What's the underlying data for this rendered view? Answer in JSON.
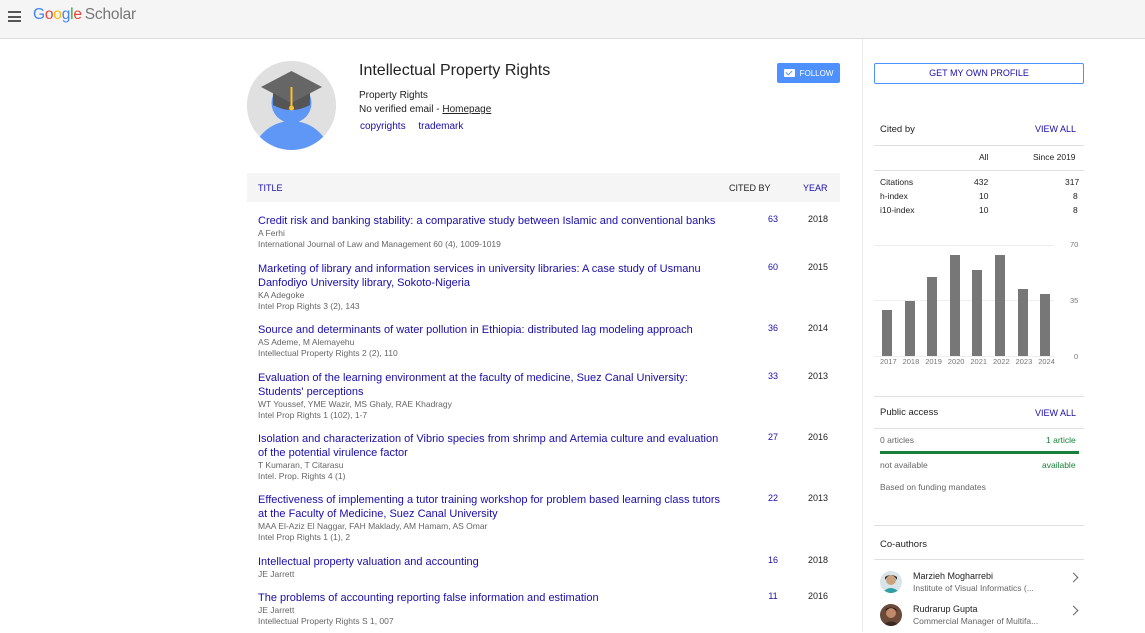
{
  "header": {
    "logo_google": "Google",
    "logo_scholar": "Scholar",
    "logo_colors": [
      "#4285f4",
      "#ea4335",
      "#fbbc05",
      "#4285f4",
      "#34a853",
      "#ea4335"
    ]
  },
  "profile": {
    "name": "Intellectual Property Rights",
    "affiliation": "Property Rights",
    "email_text": "No verified email - ",
    "homepage_label": "Homepage",
    "interests": [
      "copyrights",
      "trademark"
    ],
    "follow_label": "FOLLOW"
  },
  "table": {
    "col_title": "TITLE",
    "col_cited_by": "CITED BY",
    "col_year": "YEAR",
    "rows": [
      {
        "title": "Credit risk and banking stability: a comparative study between Islamic and conventional banks",
        "authors": "A Ferhi",
        "venue": "International Journal of Law and Management 60 (4), 1009-1019",
        "cited": "63",
        "year": "2018"
      },
      {
        "title": "Marketing of library and information services in university libraries: A case study of Usmanu Danfodiyo University library, Sokoto-Nigeria",
        "authors": "KA Adegoke",
        "venue": "Intel Prop Rights 3 (2), 143",
        "cited": "60",
        "year": "2015"
      },
      {
        "title": "Source and determinants of water pollution in Ethiopia: distributed lag modeling approach",
        "authors": "AS Ademe, M Alemayehu",
        "venue": "Intellectual Property Rights 2 (2), 110",
        "cited": "36",
        "year": "2014"
      },
      {
        "title": "Evaluation of the learning environment at the faculty of medicine, Suez Canal University: Students' perceptions",
        "authors": "WT Youssef, YME Wazir, MS Ghaly, RAE Khadragy",
        "venue": "Intel Prop Rights 1 (102), 1-7",
        "cited": "33",
        "year": "2013"
      },
      {
        "title": "Isolation and characterization of Vibrio species from shrimp and Artemia culture and evaluation of the potential virulence factor",
        "authors": "T Kumaran, T Citarasu",
        "venue": "Intel. Prop. Rights 4 (1)",
        "cited": "27",
        "year": "2016"
      },
      {
        "title": "Effectiveness of implementing a tutor training workshop for problem based learning class tutors at the Faculty of Medicine, Suez Canal University",
        "authors": "MAA El-Aziz El Naggar, FAH Maklady, AM Hamam, AS Omar",
        "venue": "Intel Prop Rights 1 (1), 2",
        "cited": "22",
        "year": "2013"
      },
      {
        "title": "Intellectual property valuation and accounting",
        "authors": "JE Jarrett",
        "venue": "",
        "cited": "16",
        "year": "2018"
      },
      {
        "title": "The problems of accounting reporting false information and estimation",
        "authors": "JE Jarrett",
        "venue": "Intellectual Property Rights S 1, 007",
        "cited": "11",
        "year": "2016"
      }
    ]
  },
  "sidebar": {
    "get_profile_label": "GET MY OWN PROFILE",
    "cited_by": {
      "heading": "Cited by",
      "view_all": "VIEW ALL",
      "col_all": "All",
      "col_since": "Since 2019",
      "metrics": [
        {
          "label": "Citations",
          "all": "432",
          "since": "317"
        },
        {
          "label": "h-index",
          "all": "10",
          "since": "8"
        },
        {
          "label": "i10-index",
          "all": "10",
          "since": "8"
        }
      ]
    },
    "chart_data": {
      "type": "bar",
      "categories": [
        "2017",
        "2018",
        "2019",
        "2020",
        "2021",
        "2022",
        "2023",
        "2024"
      ],
      "values": [
        29,
        35,
        50,
        64,
        54,
        64,
        42,
        39
      ],
      "ylim": [
        0,
        70
      ],
      "yticks": [
        "70",
        "35",
        "0"
      ],
      "bar_color": "#777777"
    },
    "public_access": {
      "heading": "Public access",
      "view_all": "VIEW ALL",
      "left_count": "0 articles",
      "right_count": "1 article",
      "left_status": "not available",
      "right_status": "available",
      "available_fraction": 1.0,
      "mandate_note": "Based on funding mandates"
    },
    "coauthors": {
      "heading": "Co-authors",
      "items": [
        {
          "name": "Marzieh Mogharrebi",
          "affiliation": "Institute of Visual Informatics (..."
        },
        {
          "name": "Rudrarup Gupta",
          "affiliation": "Commercial Manager of Multifa..."
        }
      ]
    }
  }
}
